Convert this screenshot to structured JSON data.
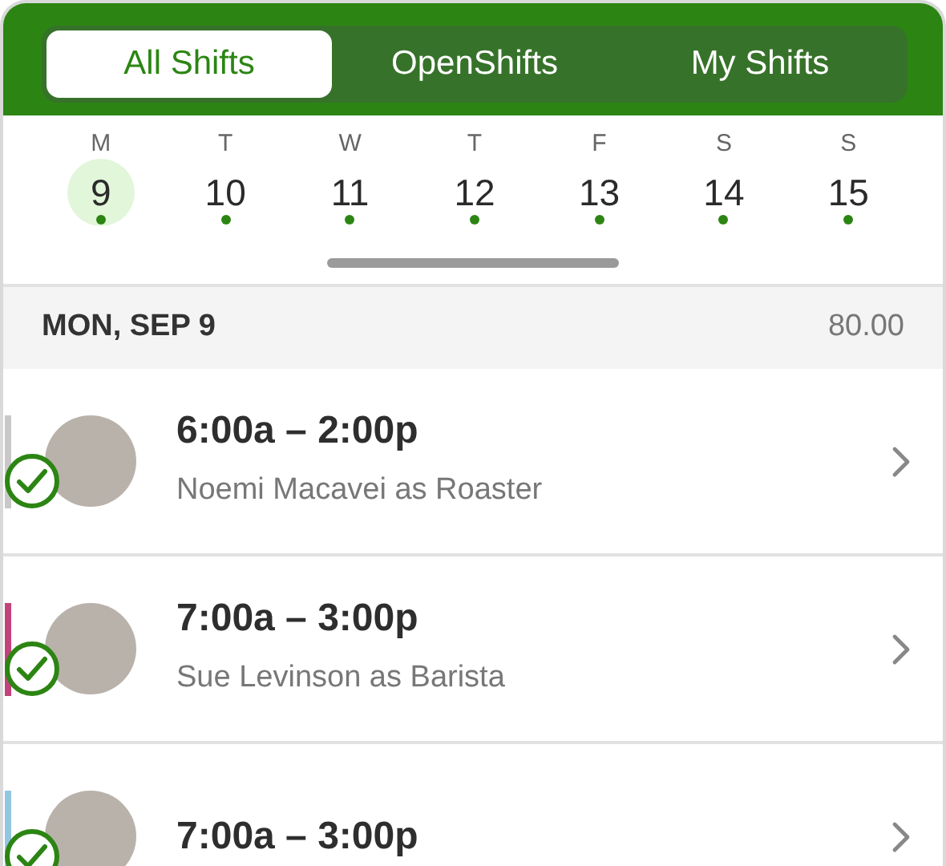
{
  "tabs": [
    {
      "label": "All Shifts",
      "selected": true
    },
    {
      "label": "OpenShifts",
      "selected": false
    },
    {
      "label": "My Shifts",
      "selected": false
    }
  ],
  "week": [
    {
      "weekday": "M",
      "date": "9",
      "selected": true,
      "has_shifts": true
    },
    {
      "weekday": "T",
      "date": "10",
      "selected": false,
      "has_shifts": true
    },
    {
      "weekday": "W",
      "date": "11",
      "selected": false,
      "has_shifts": true
    },
    {
      "weekday": "T",
      "date": "12",
      "selected": false,
      "has_shifts": true
    },
    {
      "weekday": "F",
      "date": "13",
      "selected": false,
      "has_shifts": true
    },
    {
      "weekday": "S",
      "date": "14",
      "selected": false,
      "has_shifts": true
    },
    {
      "weekday": "S",
      "date": "15",
      "selected": false,
      "has_shifts": true
    }
  ],
  "day_header": {
    "date": "MON, SEP 9",
    "hours": "80.00"
  },
  "shifts": [
    {
      "time": "6:00a – 2:00p",
      "assignee": "Noemi Macavei as Roaster",
      "color": "#c8c8c8",
      "confirmed": true
    },
    {
      "time": "7:00a – 3:00p",
      "assignee": "Sue Levinson as Barista",
      "color": "#c2437c",
      "confirmed": true
    },
    {
      "time": "7:00a – 3:00p",
      "color": "#93c6e2",
      "confirmed": true
    }
  ]
}
